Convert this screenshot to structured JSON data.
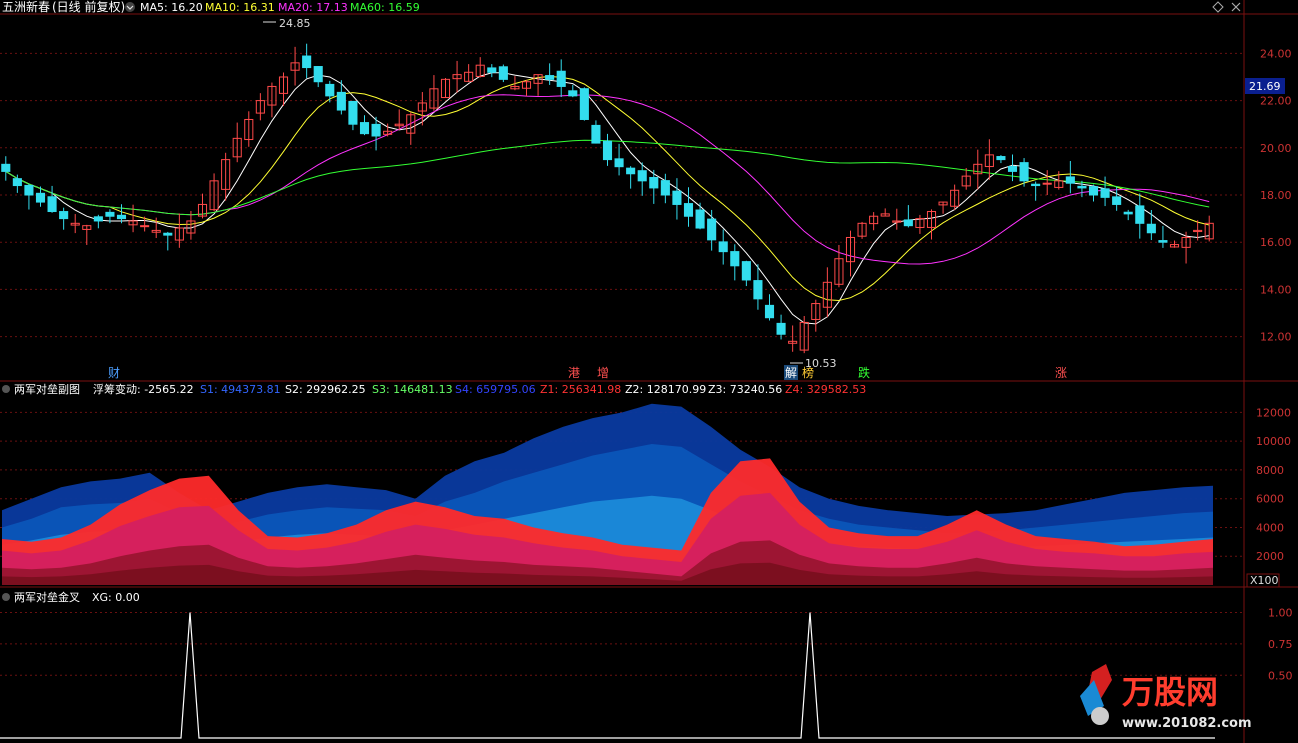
{
  "stock": {
    "name": "五洲新春",
    "period": "(日线 前复权)"
  },
  "top_icons": [
    "diamond-icon",
    "close-icon"
  ],
  "main_panel": {
    "indicators": [
      {
        "label": "MA5: 16.20",
        "color": "#ffffff"
      },
      {
        "label": "MA10: 16.31",
        "color": "#ffff33"
      },
      {
        "label": "MA20: 17.13",
        "color": "#ff33ff"
      },
      {
        "label": "MA60: 16.59",
        "color": "#33ff33"
      }
    ],
    "y_ticks": [
      "24.00",
      "22.00",
      "20.00",
      "18.00",
      "16.00",
      "14.00",
      "12.00"
    ],
    "price_tag": "21.69",
    "high_label": "24.85",
    "low_label": "10.53",
    "markers": [
      {
        "text": "财",
        "color": "#4d9fff"
      },
      {
        "text": "港",
        "color": "#ff5050"
      },
      {
        "text": "增",
        "color": "#ff5050"
      },
      {
        "text": "解",
        "color": "#4d9fff"
      },
      {
        "text": "榜",
        "color": "#ffcc33"
      },
      {
        "text": "跌",
        "color": "#33ff33"
      },
      {
        "text": "涨",
        "color": "#ff5050"
      }
    ]
  },
  "sub_panel_1": {
    "title": "两军对垒副图",
    "indicators": [
      {
        "label": "浮筹变动: -2565.22",
        "color": "#ffffff"
      },
      {
        "label": "S1: 494373.81",
        "color": "#3366ff"
      },
      {
        "label": "S2: 292962.25",
        "color": "#ffffff"
      },
      {
        "label": "S3: 146481.13",
        "color": "#66ff66"
      },
      {
        "label": "S4: 659795.06",
        "color": "#3344ff"
      },
      {
        "label": "Z1: 256341.98",
        "color": "#ff3333"
      },
      {
        "label": "Z2: 128170.99",
        "color": "#ffffff"
      },
      {
        "label": "Z3: 73240.56",
        "color": "#ffffff"
      },
      {
        "label": "Z4: 329582.53",
        "color": "#ff3333"
      }
    ],
    "y_ticks": [
      "12000",
      "10000",
      "8000",
      "6000",
      "4000",
      "2000"
    ],
    "unit_tag": "X100"
  },
  "sub_panel_2": {
    "title": "两军对垒金叉",
    "indicators": [
      {
        "label": "XG: 0.00",
        "color": "#ffffff"
      }
    ],
    "y_ticks": [
      "1.00",
      "0.75",
      "0.50"
    ]
  },
  "logo": {
    "name": "万股网",
    "url": "www.201082.com"
  },
  "chart_data": [
    {
      "type": "candlestick",
      "title": "五洲新春 (日线 前复权)",
      "ylim": [
        10.5,
        25.5
      ],
      "close": [
        19.0,
        18.4,
        18.0,
        17.7,
        17.3,
        17.0,
        16.8,
        16.7,
        16.9,
        17.1,
        17.0,
        16.9,
        16.7,
        16.5,
        16.3,
        16.6,
        16.9,
        17.6,
        18.6,
        19.5,
        20.4,
        21.2,
        22.0,
        22.6,
        23.0,
        23.6,
        23.4,
        22.8,
        22.2,
        21.6,
        21.0,
        20.6,
        20.5,
        20.7,
        21.0,
        21.4,
        21.9,
        22.5,
        22.9,
        23.1,
        23.2,
        23.5,
        23.2,
        22.9,
        22.6,
        22.8,
        23.1,
        22.9,
        22.6,
        22.2,
        21.2,
        20.2,
        19.5,
        19.2,
        18.9,
        18.6,
        18.3,
        18.0,
        17.6,
        17.1,
        16.6,
        16.1,
        15.6,
        15.0,
        14.4,
        13.6,
        12.8,
        12.1,
        11.8,
        12.6,
        13.4,
        14.3,
        15.3,
        16.2,
        16.8,
        17.1,
        17.2,
        16.9,
        16.7,
        17.0,
        17.3,
        17.7,
        18.2,
        18.8,
        19.3,
        19.7,
        19.5,
        19.0,
        18.6,
        18.4,
        18.5,
        18.6,
        18.5,
        18.3,
        18.0,
        17.9,
        17.6,
        17.2,
        16.8,
        16.4,
        16.0,
        15.9,
        16.2,
        16.5,
        16.8
      ],
      "ma5": 16.2,
      "ma10": 16.31,
      "ma20": 17.13,
      "ma60": 16.59,
      "high": 24.85,
      "low": 10.53
    },
    {
      "type": "area",
      "title": "两军对垒副图",
      "ylim": [
        0,
        13000
      ],
      "ylabel": "X100",
      "series": [
        {
          "name": "S4",
          "values": [
            5200,
            6000,
            6800,
            7200,
            7400,
            7800,
            6400,
            5200,
            5800,
            6400,
            6800,
            7000,
            6800,
            6600,
            6000,
            7600,
            8600,
            9200,
            10200,
            11000,
            11600,
            12000,
            12600,
            12400,
            11000,
            9400,
            8200,
            6800,
            6000,
            5500,
            5200,
            5000,
            4800,
            4900,
            5000,
            5200,
            5600,
            6000,
            6400,
            6600,
            6800,
            6900
          ]
        },
        {
          "name": "S1",
          "values": [
            4000,
            4600,
            5400,
            5600,
            5700,
            6000,
            5000,
            4000,
            4400,
            4900,
            5200,
            5400,
            5300,
            5200,
            4800,
            5800,
            6400,
            7200,
            7800,
            8400,
            9000,
            9400,
            9800,
            9600,
            8400,
            7200,
            6200,
            5200,
            4600,
            4200,
            4000,
            3800,
            3600,
            3700,
            3800,
            4000,
            4200,
            4400,
            4600,
            4800,
            5000,
            5100
          ]
        },
        {
          "name": "S2",
          "values": [
            2800,
            3100,
            3500,
            3700,
            3800,
            3900,
            3300,
            2800,
            3000,
            3300,
            3500,
            3600,
            3500,
            3400,
            3200,
            3800,
            4200,
            4600,
            5000,
            5400,
            5800,
            6000,
            6200,
            6000,
            5200,
            4400,
            3800,
            3200,
            2900,
            2700,
            2600,
            2500,
            2400,
            2500,
            2600,
            2700,
            2800,
            2900,
            3000,
            3100,
            3200,
            3300
          ]
        },
        {
          "name": "Z4",
          "values": [
            3200,
            3000,
            3300,
            4200,
            5600,
            6600,
            7400,
            7600,
            5200,
            3400,
            3300,
            3600,
            4200,
            5200,
            5800,
            5400,
            4800,
            4600,
            4000,
            3600,
            3300,
            2800,
            2600,
            2400,
            6400,
            8600,
            8800,
            5800,
            4000,
            3600,
            3400,
            3400,
            4200,
            5200,
            4200,
            3400,
            3200,
            3000,
            2700,
            2800,
            3000,
            3200
          ]
        },
        {
          "name": "Z1",
          "values": [
            2400,
            2200,
            2400,
            3100,
            4100,
            4800,
            5400,
            5500,
            3800,
            2500,
            2400,
            2600,
            3000,
            3700,
            4200,
            3900,
            3500,
            3300,
            2900,
            2600,
            2400,
            2000,
            1800,
            1600,
            4600,
            6200,
            6400,
            4200,
            2900,
            2600,
            2500,
            2500,
            3000,
            3800,
            3000,
            2500,
            2300,
            2200,
            2000,
            2000,
            2200,
            2300
          ]
        },
        {
          "name": "Z3",
          "values": [
            1200,
            1100,
            1200,
            1500,
            2000,
            2400,
            2700,
            2800,
            1900,
            1300,
            1200,
            1300,
            1500,
            1800,
            2100,
            1900,
            1700,
            1600,
            1400,
            1300,
            1200,
            1000,
            800,
            600,
            2200,
            3000,
            3100,
            2100,
            1500,
            1300,
            1200,
            1200,
            1500,
            1900,
            1500,
            1300,
            1200,
            1100,
            1000,
            1000,
            1100,
            1200
          ]
        },
        {
          "name": "Z2",
          "values": [
            600,
            550,
            600,
            750,
            1000,
            1200,
            1350,
            1400,
            950,
            650,
            600,
            650,
            750,
            900,
            1050,
            950,
            850,
            800,
            700,
            650,
            600,
            500,
            400,
            300,
            1100,
            1500,
            1550,
            1050,
            750,
            650,
            600,
            600,
            750,
            950,
            750,
            650,
            600,
            550,
            500,
            500,
            550,
            600
          ]
        }
      ]
    },
    {
      "type": "line",
      "title": "两军对垒金叉",
      "ylim": [
        0,
        1.1
      ],
      "series": [
        {
          "name": "XG",
          "values": [
            0,
            0,
            0,
            0,
            0,
            0,
            0,
            0,
            0,
            0,
            0,
            0,
            0,
            0,
            0,
            0,
            0,
            0,
            0,
            0,
            0,
            0,
            0,
            0,
            0,
            0,
            0,
            0,
            0,
            0,
            0,
            0,
            0,
            0,
            0,
            0,
            0,
            0,
            0,
            0,
            0,
            0,
            0,
            0,
            0,
            0,
            0,
            0,
            0,
            0,
            0,
            0,
            0,
            0,
            0,
            0,
            0,
            0,
            0,
            0,
            0,
            0,
            0,
            0,
            0,
            0,
            0,
            0,
            0,
            0,
            0,
            0,
            0,
            0,
            0,
            0,
            0,
            0,
            0,
            0,
            0,
            0,
            0,
            0,
            0,
            0,
            0,
            0,
            0,
            0,
            0,
            0,
            0,
            0,
            0,
            0,
            0,
            0,
            0,
            0,
            0,
            0,
            0,
            0,
            0
          ]
        },
        {
          "name": "XG-peaks",
          "values": [
            [
              190,
              1.0
            ],
            [
              810,
              1.0
            ]
          ]
        }
      ]
    }
  ]
}
